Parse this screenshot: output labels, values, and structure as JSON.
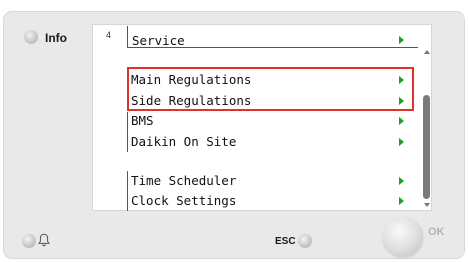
{
  "panel": {
    "info_label": "Info",
    "esc_label": "ESC",
    "ok_label": "OK"
  },
  "menu": {
    "page_number": "4",
    "title": "Service",
    "items": [
      {
        "label": "Main Regulations",
        "highlighted": true
      },
      {
        "label": "Side Regulations",
        "highlighted": true
      },
      {
        "label": "BMS",
        "highlighted": false
      },
      {
        "label": "Daikin On Site",
        "highlighted": false
      },
      {
        "label": "Time Scheduler",
        "highlighted": false
      },
      {
        "label": "Clock Settings",
        "highlighted": false
      }
    ]
  },
  "colors": {
    "arrow": "#1e9f1e",
    "highlight_border": "#e0312b",
    "device_body": "#e9e9e9"
  },
  "icons": {
    "info_led": "led-indicator",
    "alarm": "bell-icon",
    "esc_led": "led-indicator",
    "menu_arrow": "triangle-right-icon"
  }
}
